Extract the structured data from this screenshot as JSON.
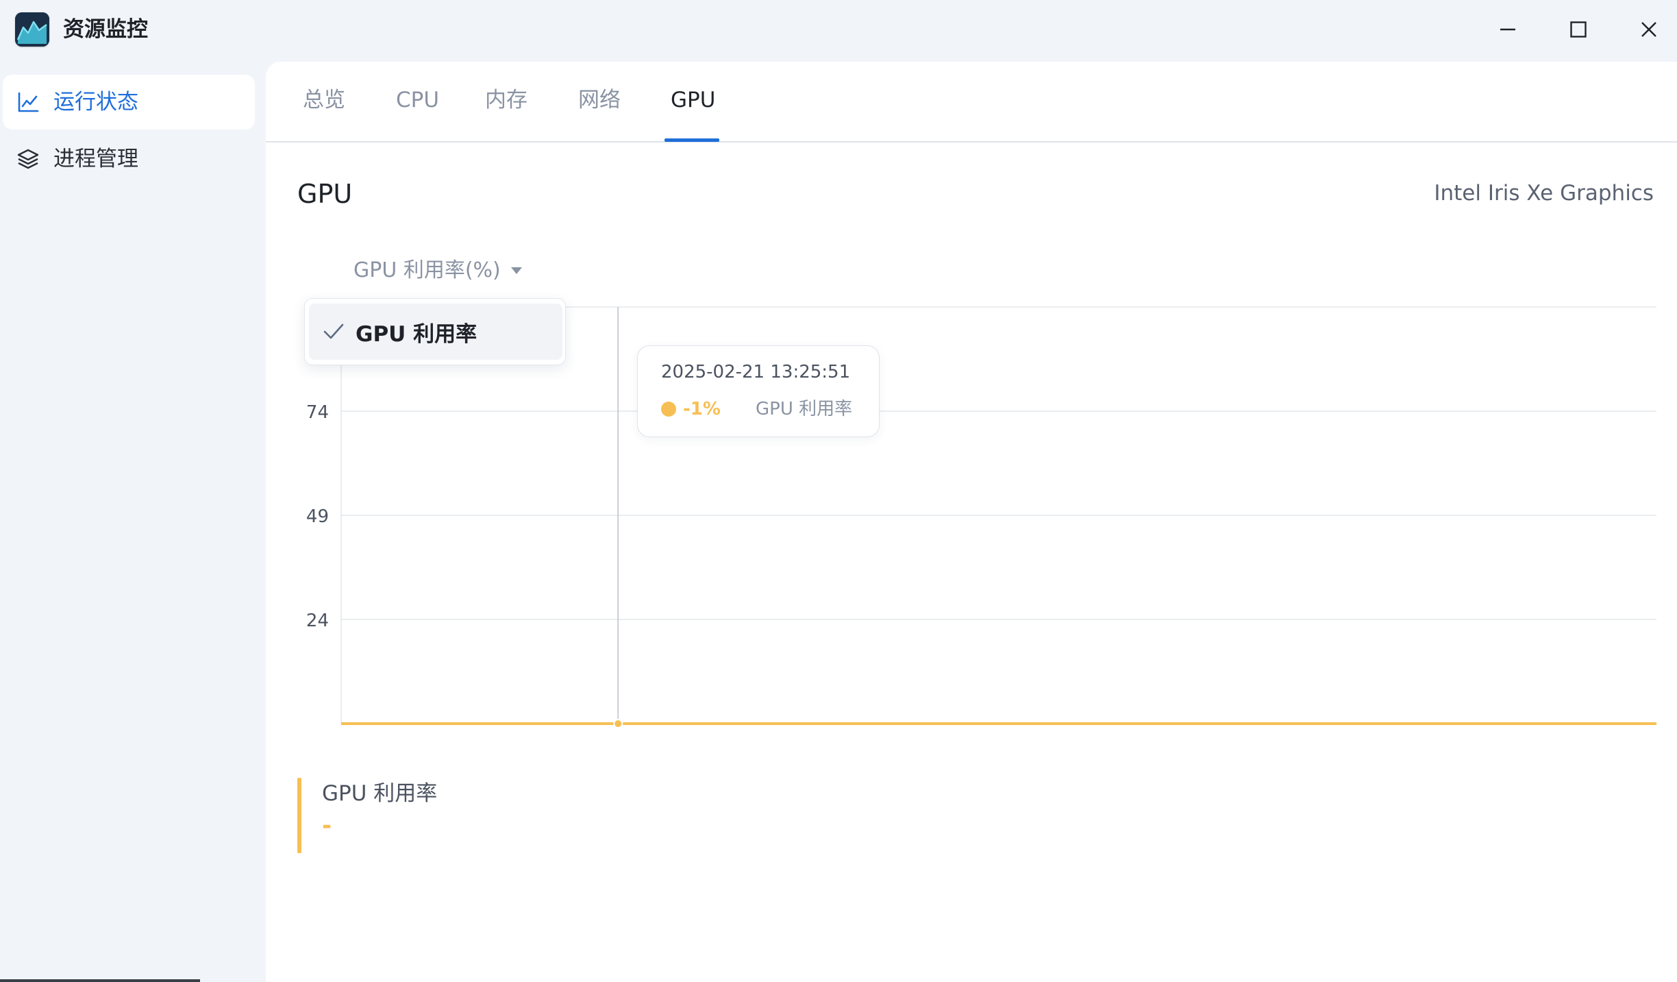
{
  "app": {
    "title": "资源监控",
    "logo_icon": "chart-area-logo-icon",
    "window_controls": {
      "minimize_icon": "minimize-icon",
      "maximize_icon": "maximize-icon",
      "close_icon": "close-icon"
    }
  },
  "sidebar": {
    "items": [
      {
        "label": "运行状态",
        "icon": "line-chart-icon",
        "active": true
      },
      {
        "label": "进程管理",
        "icon": "layers-icon",
        "active": false
      }
    ]
  },
  "tabs": {
    "items": [
      {
        "label": "总览",
        "active": false
      },
      {
        "label": "CPU",
        "active": false
      },
      {
        "label": "内存",
        "active": false
      },
      {
        "label": "网络",
        "active": false
      },
      {
        "label": "GPU",
        "active": true
      }
    ]
  },
  "section": {
    "title": "GPU",
    "device": "Intel Iris Xe Graphics"
  },
  "metric_select": {
    "value": "GPU 利用率(%)",
    "options": [
      {
        "label": "GPU 利用率",
        "checked": true
      }
    ]
  },
  "tooltip": {
    "time": "2025-02-21 13:25:51",
    "value": "-1%",
    "series": "GPU 利用率"
  },
  "legend": {
    "name": "GPU 利用率",
    "value": "-"
  },
  "colors": {
    "accent": "#1f6fd9",
    "series": "#f7bf53",
    "grid": "#e4e7ec",
    "axis_text": "#4b5260"
  },
  "chart_data": {
    "type": "line",
    "ylabel": "",
    "y_ticks": [
      24,
      49,
      74,
      99
    ],
    "y_tick_labels_visible": [
      "74",
      "49",
      "24"
    ],
    "ylim": [
      -1,
      99
    ],
    "grid": true,
    "series": [
      {
        "name": "GPU 利用率",
        "values": [
          -1,
          -1,
          -1,
          -1,
          -1,
          -1,
          -1,
          -1,
          -1,
          -1,
          -1,
          -1,
          -1,
          -1,
          -1,
          -1,
          -1,
          -1,
          -1,
          -1
        ]
      }
    ],
    "hover_index": 4
  }
}
